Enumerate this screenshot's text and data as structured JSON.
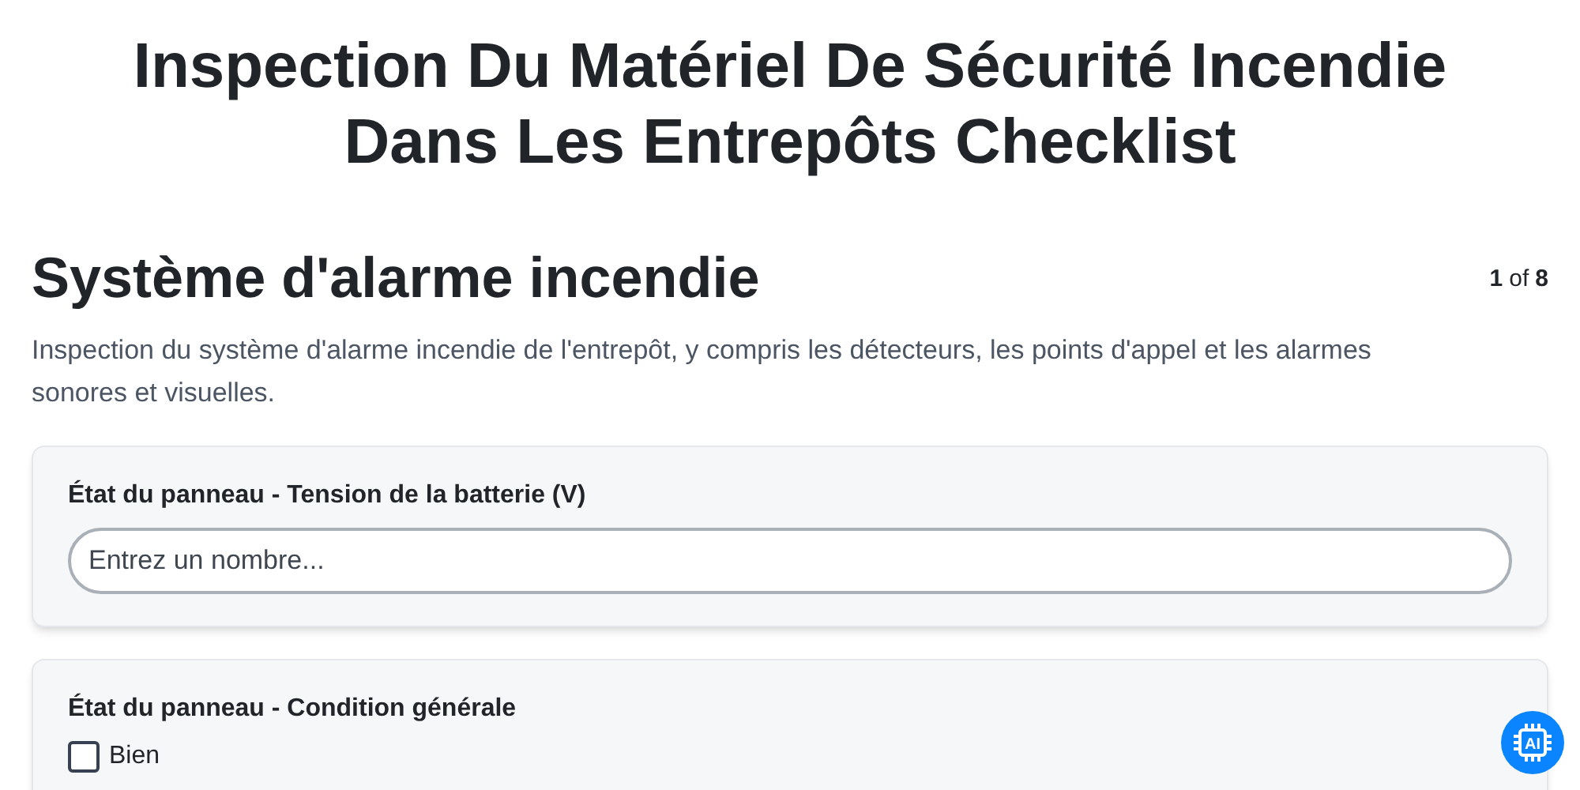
{
  "title": "Inspection Du Matériel De Sécurité Incendie Dans Les Entrepôts Checklist",
  "section": {
    "heading": "Système d'alarme incendie",
    "page_current": "1",
    "page_of": "of",
    "page_total": "8",
    "description": "Inspection du système d'alarme incendie de l'entrepôt, y compris les détecteurs, les points d'appel et les alarmes sonores et visuelles."
  },
  "questions": [
    {
      "kind": "number",
      "label": "État du panneau - Tension de la batterie (V)",
      "placeholder": "Entrez un nombre..."
    },
    {
      "kind": "checkbox",
      "label": "État du panneau - Condition générale",
      "options": [
        {
          "label": "Bien",
          "checked": false
        }
      ]
    }
  ],
  "ai_button": {
    "label": "AI"
  }
}
